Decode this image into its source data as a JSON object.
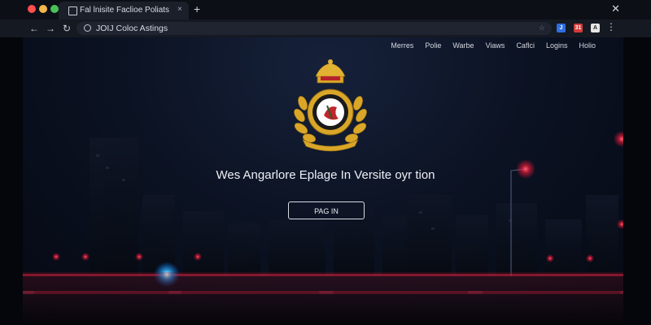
{
  "browser": {
    "tab_title": "Fal lnisite Faclioe Poliats",
    "tab_close": "×",
    "new_tab": "+",
    "window_close": "✕",
    "address": "JOIJ Coloc Astings",
    "ext_icons": [
      "blue-extension-icon",
      "calendar-extension-icon",
      "account-extension-icon"
    ],
    "ext_labels": [
      "J",
      "31",
      "A"
    ]
  },
  "site": {
    "nav": [
      "Merres",
      "Polie",
      "Warbe",
      "Viaws",
      "Caflci",
      "Logins",
      "Holio"
    ],
    "headline": "Wes Angarlore Eplage In Versite oyr tion",
    "cta_label": "PAG IN"
  },
  "colors": {
    "accent_red": "#ff2a4a",
    "accent_blue": "#2aa8ff",
    "gold": "#d9a628"
  }
}
